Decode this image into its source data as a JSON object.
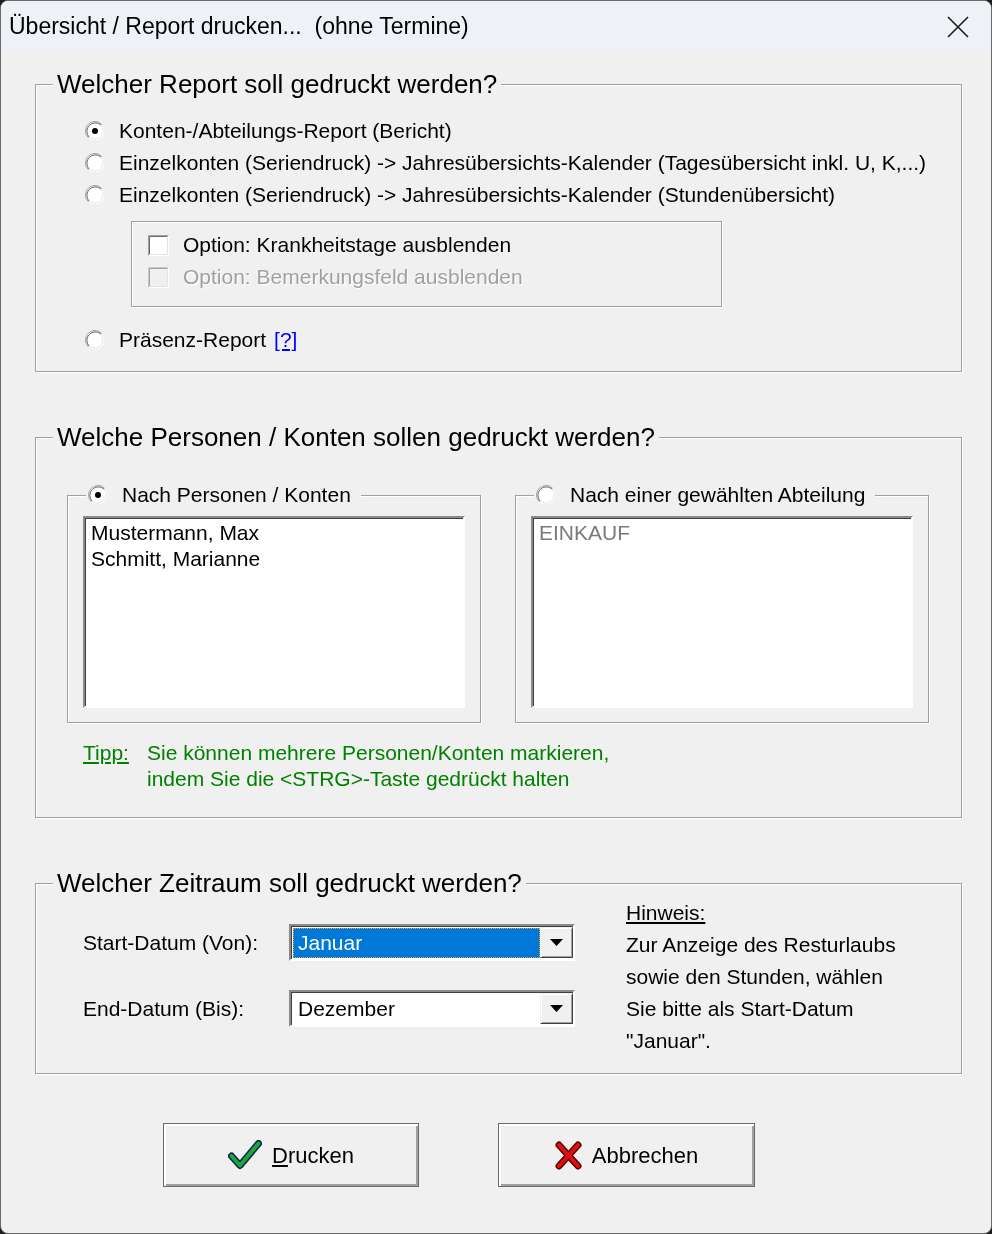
{
  "window": {
    "title": "Übersicht / Report drucken...  (ohne Termine)"
  },
  "report_group": {
    "title": "Welcher Report soll gedruckt werden?",
    "items": [
      {
        "kind": "radio",
        "label": "Konten-/Abteilungs-Report (Bericht)",
        "selected": true
      },
      {
        "kind": "radio",
        "label": "Einzelkonten (Seriendruck) -> Jahresübersichts-Kalender (Tagesübersicht inkl. U, K,...)",
        "selected": false
      },
      {
        "kind": "radio",
        "label": "Einzelkonten (Seriendruck) -> Jahresübersichts-Kalender (Stundenübersicht)",
        "selected": false
      },
      {
        "kind": "option_box",
        "options": [
          {
            "label": "Option: Krankheitstage ausblenden",
            "checked": false,
            "disabled": false
          },
          {
            "label": "Option: Bemerkungsfeld ausblenden",
            "checked": false,
            "disabled": true
          }
        ]
      },
      {
        "kind": "radio",
        "label": "Präsenz-Report",
        "selected": false,
        "help_link": "[?]"
      }
    ]
  },
  "persons_group": {
    "title": "Welche Personen / Konten sollen gedruckt werden?",
    "sources": [
      {
        "label": "Nach Personen / Konten",
        "selected": true,
        "disabled": false,
        "entries": [
          {
            "label": "Mustermann, Max",
            "selected": false
          },
          {
            "label": "Schmitt, Marianne",
            "selected": false
          }
        ]
      },
      {
        "label": "Nach einer gewählten Abteilung",
        "selected": false,
        "disabled": true,
        "entries": [
          {
            "label": "EINKAUF",
            "selected": false
          }
        ]
      }
    ],
    "tip": {
      "label": "Tipp:",
      "text": "Sie können mehrere Personen/Konten markieren,\nindem Sie die <STRG>-Taste gedrückt halten"
    }
  },
  "period_group": {
    "title": "Welcher Zeitraum soll gedruckt werden?",
    "fields": [
      {
        "label": "Start-Datum (Von):",
        "value": "Januar",
        "focused": true
      },
      {
        "label": "End-Datum (Bis):",
        "value": "Dezember",
        "focused": false
      }
    ],
    "note": {
      "title": "Hinweis:",
      "text": "Zur Anzeige des Resturlaubs\nsowie den Stunden, wählen\nSie bitte als Start-Datum\n\"Januar\"."
    }
  },
  "buttons": [
    {
      "kind": "confirm",
      "label": "Drucken",
      "mnemonic": true
    },
    {
      "kind": "cancel",
      "label": "Abbrechen",
      "mnemonic": false
    }
  ]
}
